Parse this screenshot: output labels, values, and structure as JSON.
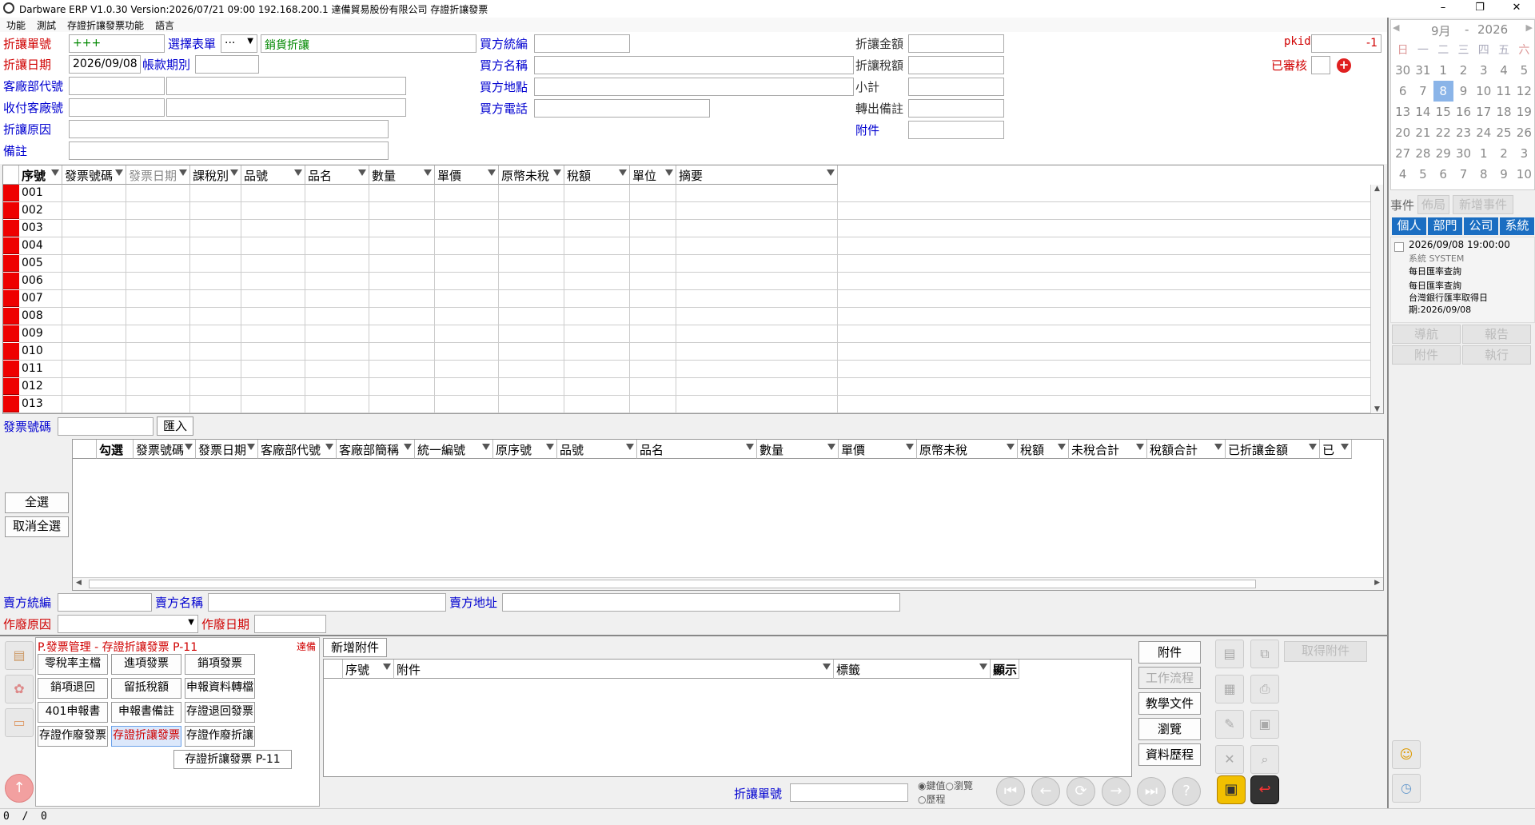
{
  "titlebar": {
    "title": "Darbware ERP V1.0.30 Version:2026/07/21 09:00    192.168.200.1 達備貿易股份有限公司 存證折讓發票"
  },
  "menu": [
    "功能",
    "測試",
    "存證折讓發票功能",
    "語言"
  ],
  "form": {
    "doc_no_label": "折讓單號",
    "doc_no_value": "+++",
    "select_form_label": "選擇表單",
    "select_form_value": "···",
    "form_type_value": "銷貨折讓",
    "doc_date_label": "折讓日期",
    "doc_date_value": "2026/09/08",
    "period_label": "帳款期別",
    "customer_dept_label": "客廠部代號",
    "payee_label": "收付客廠號",
    "reason_label": "折讓原因",
    "remark_label": "備註",
    "buyer_tax_id_label": "買方統編",
    "buyer_name_label": "買方名稱",
    "buyer_address_label": "買方地點",
    "buyer_phone_label": "買方電話",
    "amount_label": "折讓金額",
    "tax_label": "折讓稅額",
    "subtotal_label": "小計",
    "transfer_note_label": "轉出備註",
    "attachment_label": "附件",
    "pkid_label": "pkid",
    "pkid_value": "-1",
    "approved_label": "已審核"
  },
  "grid1": {
    "columns": [
      "序號",
      "發票號碼",
      "發票日期",
      "課稅別",
      "品號",
      "品名",
      "數量",
      "單價",
      "原幣未稅",
      "稅額",
      "單位",
      "摘要"
    ],
    "rows": [
      "001",
      "002",
      "003",
      "004",
      "005",
      "006",
      "007",
      "008",
      "009",
      "010",
      "011",
      "012",
      "013"
    ]
  },
  "invoice_no_label": "發票號碼",
  "import_button": "匯入",
  "grid2": {
    "columns": [
      "勾選",
      "發票號碼",
      "發票日期",
      "客廠部代號",
      "客廠部簡稱",
      "統一編號",
      "原序號",
      "品號",
      "品名",
      "數量",
      "單價",
      "原幣未稅",
      "稅額",
      "未稅合計",
      "稅額合計",
      "已折讓金額",
      "已"
    ]
  },
  "select_all": "全選",
  "deselect_all": "取消全選",
  "seller_tax_id_label": "賣方統編",
  "seller_name_label": "賣方名稱",
  "seller_address_label": "賣方地址",
  "void_reason_label": "作廢原因",
  "void_date_label": "作廢日期",
  "module": {
    "header": "P.發票管理 - 存證折讓發票  P-11",
    "company": "達備",
    "buttons": [
      "零稅率主檔",
      "進項發票",
      "銷項發票",
      "銷項退回",
      "留抵稅額",
      "申報資料轉檔",
      "401申報書",
      "申報書備註",
      "存證退回發票",
      "存證作廢發票",
      "存證折讓發票",
      "存證作廢折讓"
    ],
    "tooltip": "存證折讓發票 P-11"
  },
  "attach": {
    "add_tab": "新增附件",
    "columns": [
      "序號",
      "附件",
      "標籤",
      "顯示"
    ],
    "side_buttons": [
      "附件",
      "工作流程",
      "教學文件",
      "瀏覽",
      "資料歷程"
    ],
    "get_attachment": "取得附件"
  },
  "nav": {
    "doc_no_label": "折讓單號",
    "radio1": "鍵值",
    "radio2": "瀏覽",
    "radio3": "歷程"
  },
  "status": {
    "text": "0  /  0"
  },
  "calendar": {
    "month": "9月",
    "year": "2026",
    "weekdays": [
      "日",
      "一",
      "二",
      "三",
      "四",
      "五",
      "六"
    ],
    "weeks": [
      [
        "30",
        "31",
        "1",
        "2",
        "3",
        "4",
        "5"
      ],
      [
        "6",
        "7",
        "8",
        "9",
        "10",
        "11",
        "12"
      ],
      [
        "13",
        "14",
        "15",
        "16",
        "17",
        "18",
        "19"
      ],
      [
        "20",
        "21",
        "22",
        "23",
        "24",
        "25",
        "26"
      ],
      [
        "27",
        "28",
        "29",
        "30",
        "1",
        "2",
        "3"
      ],
      [
        "4",
        "5",
        "6",
        "7",
        "8",
        "9",
        "10"
      ]
    ],
    "selected": "8"
  },
  "events": {
    "label": "事件",
    "layout": "佈局",
    "add": "新增事件",
    "tabs": [
      "個人",
      "部門",
      "公司",
      "系統"
    ],
    "item_time": "2026/09/08 19:00:00",
    "item_src": "系統  SYSTEM",
    "item_title": "每日匯率查詢",
    "item_body1": "每日匯率查詢",
    "item_body2": "台灣銀行匯率取得日",
    "item_body3": "期:2026/09/08",
    "btns": [
      "導航",
      "報告",
      "附件",
      "執行"
    ]
  },
  "colors": {
    "accent_blue": "#1b6ec2",
    "label_red": "#d00000",
    "label_blue": "#0000d0",
    "row_marker": "#e00000"
  }
}
